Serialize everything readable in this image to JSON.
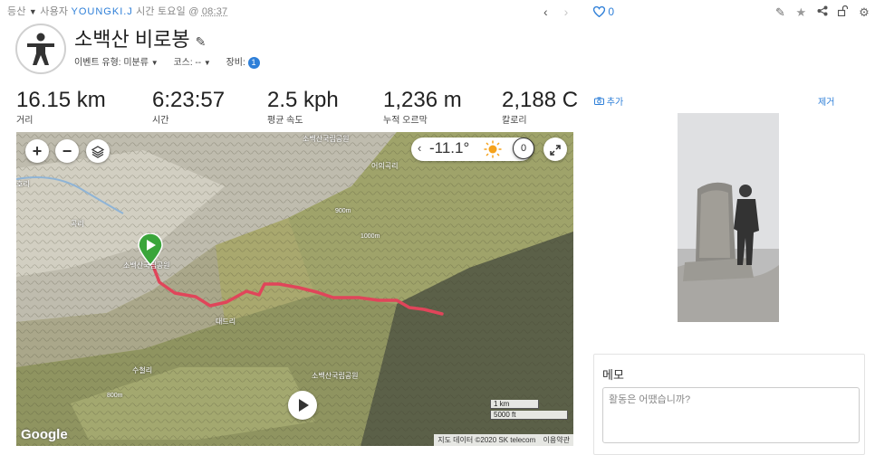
{
  "breadcrumb": {
    "activity_type": "등산",
    "user_prefix": "사용자",
    "user_name": "YOUNGKI.J",
    "time_prefix": "시간 토요일 @",
    "time_value": "08:37"
  },
  "nav": {
    "prev": "‹",
    "next": "›"
  },
  "kudos_count": "0",
  "activity": {
    "title": "소백산 비로봉",
    "event_type_label": "이벤트 유형:",
    "event_type_value": "미분류",
    "course_label": "코스:",
    "course_value": "--",
    "gear_label": "장비:",
    "gear_count": "1"
  },
  "stats": [
    {
      "value": "16.15 km",
      "label": "거리"
    },
    {
      "value": "6:23:57",
      "label": "시간"
    },
    {
      "value": "2.5 kph",
      "label": "평균 속도"
    },
    {
      "value": "1,236 m",
      "label": "누적 오르막"
    },
    {
      "value": "2,188 C",
      "label": "칼로리"
    }
  ],
  "map": {
    "temperature": "-11.1°",
    "lap_count": "0",
    "scale_km": "1 km",
    "scale_ft": "5000 ft",
    "attribution": "지도 데이터 ©2020 SK telecom",
    "terms": "이용약관",
    "google_logo": "Google",
    "labels": {
      "top_park": "소백산국립공원",
      "left_park": "소백산국립공원",
      "bottom_park": "소백산국립공원",
      "village_top": "어의곡리",
      "left_edge": "호리",
      "left_village": "곡리",
      "mid_village": "대드리",
      "lower_village": "수철리",
      "contour_900": "900m",
      "contour_1000": "1000m",
      "contour_800": "800m"
    },
    "route_color": "#e0455a",
    "start_marker_color": "#3aa53a"
  },
  "photos": {
    "add_label": "추가",
    "remove_label": "제거"
  },
  "memo": {
    "heading": "메모",
    "placeholder": "활동은 어땠습니까?"
  },
  "colors": {
    "accent": "#2e7fd8"
  }
}
